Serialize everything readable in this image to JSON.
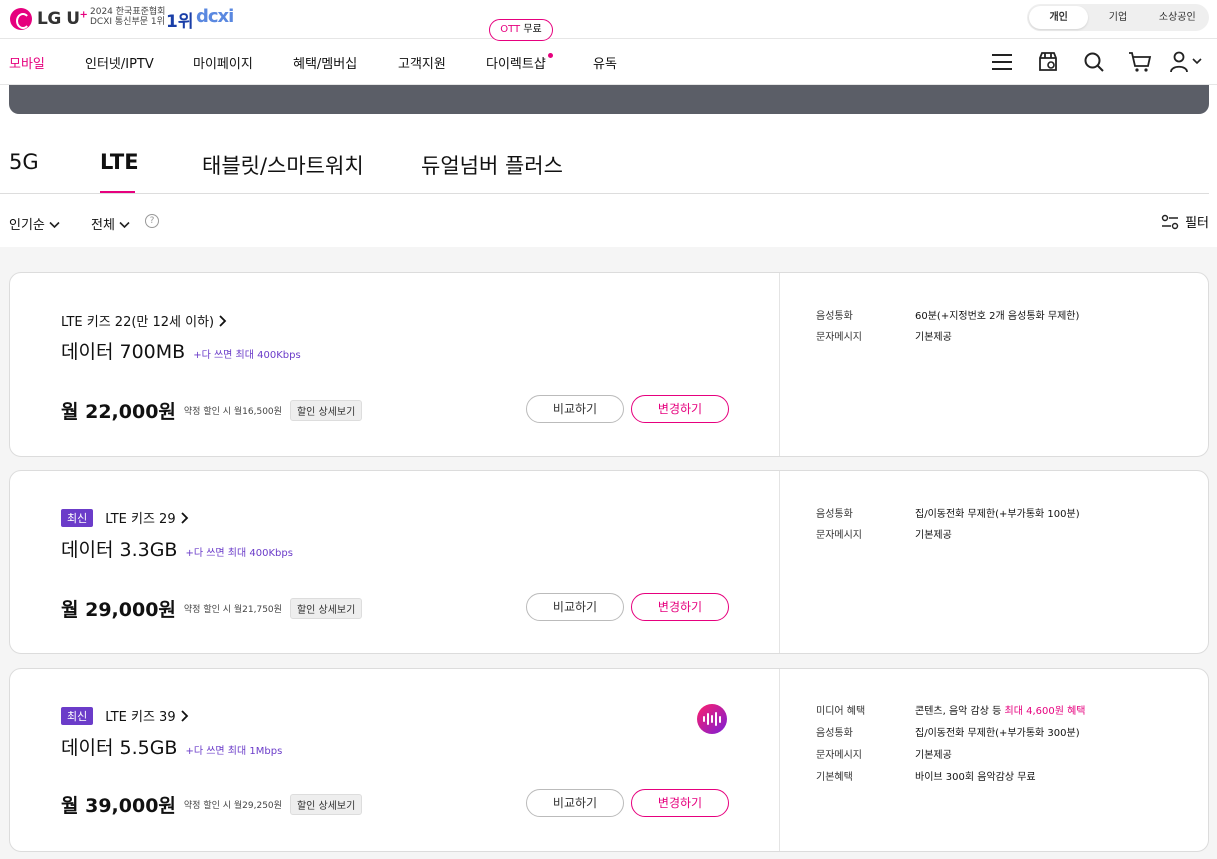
{
  "header": {
    "logo_text": "LG U",
    "logo_plus": "+",
    "award_line1": "2024 한국표준협회",
    "award_line2": "DCXI 통신부문 1위",
    "award_rank": "1위",
    "award_brand": "dcxi",
    "segments": [
      "개인",
      "기업",
      "소상공인"
    ]
  },
  "gnb": {
    "items": [
      "모바일",
      "인터넷/IPTV",
      "마이페이지",
      "혜택/멤버십",
      "고객지원",
      "다이렉트샵",
      "유독"
    ],
    "ott_bubble_a": "OTT",
    "ott_bubble_b": "무료",
    "icons": [
      "menu-icon",
      "store-icon",
      "search-icon",
      "cart-icon",
      "user-icon"
    ]
  },
  "tabs": [
    "5G",
    "LTE",
    "태블릿/스마트워치",
    "듀얼넘버 플러스"
  ],
  "filters": {
    "sort": "인기순",
    "scope": "전체",
    "help": "?",
    "filter_label": "필터"
  },
  "buttons": {
    "compare": "비교하기",
    "change": "변경하기",
    "detail": "할인 상세보기"
  },
  "plans": [
    {
      "badge": "",
      "name": "LTE 키즈 22(만 12세 이하)",
      "data": "데이터 700MB",
      "extra": "+다 쓰면 최대 400Kbps",
      "price": "월 22,000원",
      "discount": "약정 할인 시 월16,500원",
      "features": [
        {
          "key": "음성통화",
          "value": "60분(+지정번호 2개 음성통화 무제한)"
        },
        {
          "key": "문자메시지",
          "value": "기본제공"
        }
      ]
    },
    {
      "badge": "최신",
      "name": "LTE 키즈 29",
      "data": "데이터 3.3GB",
      "extra": "+다 쓰면 최대 400Kbps",
      "price": "월 29,000원",
      "discount": "약정 할인 시 월21,750원",
      "features": [
        {
          "key": "음성통화",
          "value": "집/이동전화 무제한(+부가통화 100분)"
        },
        {
          "key": "문자메시지",
          "value": "기본제공"
        }
      ]
    },
    {
      "badge": "최신",
      "name": "LTE 키즈 39",
      "data": "데이터 5.5GB",
      "extra": "+다 쓰면 최대 1Mbps",
      "price": "월 39,000원",
      "discount": "약정 할인 시 월29,250원",
      "media_prefix": "콘텐츠, 음악 감상 등 ",
      "media_highlight": "최대 4,600원 혜택",
      "features": [
        {
          "key": "미디어 혜택",
          "value": ""
        },
        {
          "key": "음성통화",
          "value": "집/이동전화 무제한(+부가통화 300분)"
        },
        {
          "key": "문자메시지",
          "value": "기본제공"
        },
        {
          "key": "기본혜택",
          "value": "바이브 300회 음악감상 무료"
        }
      ]
    }
  ],
  "colors": {
    "accent": "#e6007e",
    "purple": "#6b3cc9",
    "banner": "#5b5e67"
  }
}
